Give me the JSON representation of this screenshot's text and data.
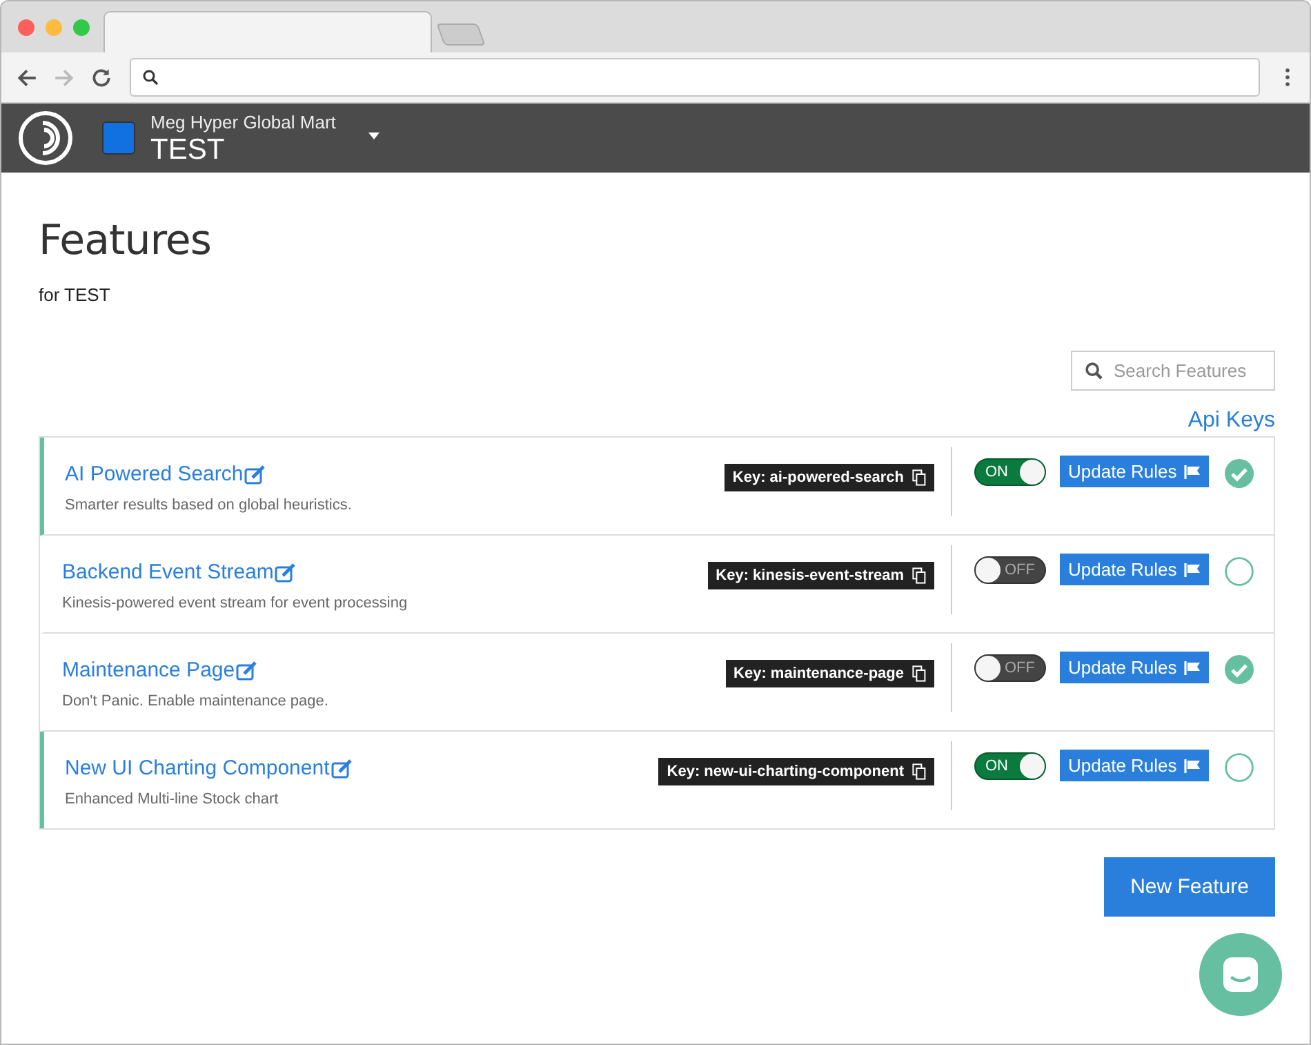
{
  "header": {
    "org": "Meg Hyper Global Mart",
    "project": "TEST"
  },
  "page": {
    "title": "Features",
    "subtitle": "for TEST"
  },
  "search": {
    "placeholder": "Search Features"
  },
  "api_keys_link": "Api Keys",
  "features": [
    {
      "name": "AI Powered Search",
      "description": "Smarter results based on global heuristics.",
      "key": "Key: ai-powered-search",
      "on": true,
      "toggle_label": "ON",
      "button": "Update Rules",
      "checked": true
    },
    {
      "name": "Backend Event Stream",
      "description": "Kinesis-powered event stream for event processing",
      "key": "Key: kinesis-event-stream",
      "on": false,
      "toggle_label": "OFF",
      "button": "Update Rules",
      "checked": false
    },
    {
      "name": "Maintenance Page",
      "description": "Don't Panic. Enable maintenance page.",
      "key": "Key: maintenance-page",
      "on": false,
      "toggle_label": "OFF",
      "button": "Update Rules",
      "checked": true
    },
    {
      "name": "New UI Charting Component",
      "description": "Enhanced Multi-line Stock chart",
      "key": "Key: new-ui-charting-component",
      "on": true,
      "toggle_label": "ON",
      "button": "Update Rules",
      "checked": false
    }
  ],
  "new_button": "New Feature"
}
